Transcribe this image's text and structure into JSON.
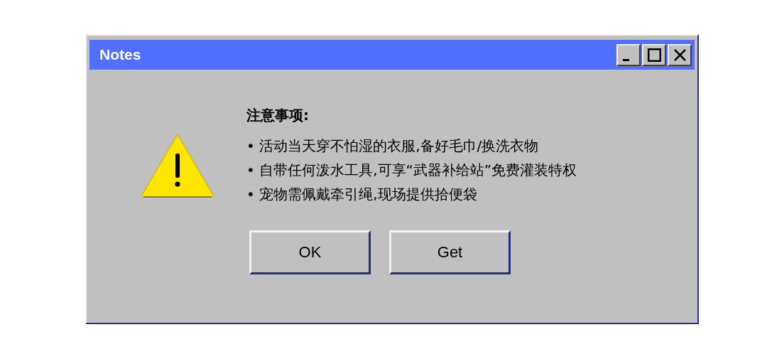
{
  "window": {
    "title": "Notes",
    "controls": [
      {
        "kind": "minimize"
      },
      {
        "kind": "maximize"
      },
      {
        "kind": "close"
      }
    ]
  },
  "message": {
    "heading": "注意事项:",
    "items": [
      "• 活动当天穿不怕湿的衣服,备好毛巾/换洗衣物",
      "• 自带任何泼水工具,可享“武器补给站”免费灌装特权",
      "• 宠物需佩戴牵引绳,现场提供拾便袋"
    ]
  },
  "buttons": [
    "OK",
    "Get"
  ]
}
